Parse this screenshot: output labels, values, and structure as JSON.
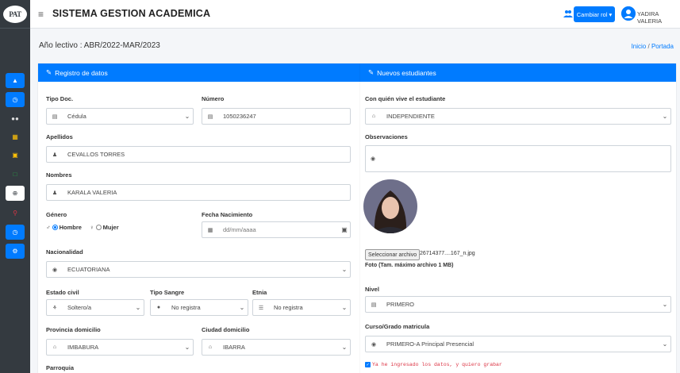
{
  "logo": {
    "text": "PAT"
  },
  "header": {
    "title": "SISTEMA GESTION ACADEMICA",
    "role_button": "Cambiar rol",
    "user_name": "YADIRA VALERIA"
  },
  "subheader": {
    "year": "Año lectivo : ABR/2022-MAR/2023",
    "breadcrumb_home": "Inicio",
    "breadcrumb_sep": "/",
    "breadcrumb_current": "Portada"
  },
  "left_card": {
    "title": "Registro de datos",
    "tipo_doc": {
      "label": "Tipo Doc.",
      "value": "Cédula"
    },
    "numero": {
      "label": "Número",
      "value": "1050236247"
    },
    "apellidos": {
      "label": "Apellidos",
      "value": "CEVALLOS TORRES"
    },
    "nombres": {
      "label": "Nombres",
      "value": "KARALA VALERIA"
    },
    "genero": {
      "label": "Género",
      "option_male": "Hombre",
      "option_female": "Mujer",
      "selected": "Hombre"
    },
    "fecha_nacimiento": {
      "label": "Fecha Nacimiento",
      "placeholder": "dd/mm/aaaa"
    },
    "nacionalidad": {
      "label": "Nacionalidad",
      "value": "ECUATORIANA"
    },
    "estado_civil": {
      "label": "Estado civil",
      "value": "Soltero/a"
    },
    "tipo_sangre": {
      "label": "Tipo Sangre",
      "value": "No registra"
    },
    "etnia": {
      "label": "Etnia",
      "value": "No registra"
    },
    "provincia": {
      "label": "Provincia domicilio",
      "value": "IMBABURA"
    },
    "ciudad": {
      "label": "Ciudad domicilio",
      "value": "IBARRA"
    },
    "parroquia": {
      "label": "Parroquia"
    }
  },
  "right_card": {
    "title": "Nuevos estudiantes",
    "vive_con": {
      "label": "Con quién vive el estudiante",
      "value": "INDEPENDIENTE"
    },
    "observaciones": {
      "label": "Observaciones"
    },
    "file_button": "Seleccionar archivo",
    "file_name": "26714377....167_n.jpg",
    "photo_note": "Foto (Tam. máximo archivo 1 MB)",
    "nivel": {
      "label": "Nivel",
      "value": "PRIMERO"
    },
    "curso": {
      "label": "Curso/Grado matricula",
      "value": "PRIMERO-A Principal Presencial"
    },
    "confirm_text": "Ya he ingresado los datos, y quiero grabar"
  },
  "colors": {
    "primary": "#007bff",
    "sidebar": "#343a40",
    "confirm_text": "#dc3545"
  },
  "icons": [
    "hamburger-icon",
    "users-icon",
    "user-circle-icon",
    "edit-icon",
    "id-card-icon",
    "user-icon",
    "calendar-icon",
    "globe-icon",
    "home-icon",
    "eye-icon",
    "tint-icon",
    "list-icon",
    "check-icon"
  ]
}
